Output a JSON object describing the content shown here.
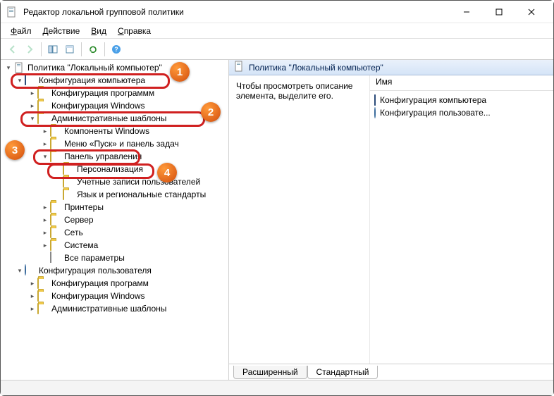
{
  "window": {
    "title": "Редактор локальной групповой политики"
  },
  "menu": {
    "file": "Файл",
    "action": "Действие",
    "view": "Вид",
    "help": "Справка"
  },
  "tree": {
    "root": "Политика \"Локальный компьютер\"",
    "computer_config": "Конфигурация компьютера",
    "cc_programs": "Конфигурация программм",
    "cc_windows": "Конфигурация Windows",
    "admin_templates": "Административные шаблоны",
    "at_components": "Компоненты Windows",
    "at_startmenu": "Меню «Пуск» и панель задач",
    "control_panel": "Панель управления",
    "cp_personalization": "Персонализация",
    "cp_accounts": "Учетные записи пользователей",
    "cp_language": "Язык и региональные стандарты",
    "at_printers": "Принтеры",
    "at_server": "Сервер",
    "at_network": "Сеть",
    "at_system": "Система",
    "at_allparams": "Все параметры",
    "user_config": "Конфигурация пользователя",
    "uc_programs": "Конфигурация программ",
    "uc_windows": "Конфигурация Windows",
    "uc_admin": "Административные шаблоны"
  },
  "right": {
    "header": "Политика \"Локальный компьютер\"",
    "description": "Чтобы просмотреть описание элемента, выделите его.",
    "col_name": "Имя",
    "item_computer": "Конфигурация компьютера",
    "item_user": "Конфигурация пользовате..."
  },
  "tabs": {
    "extended": "Расширенный",
    "standard": "Стандартный"
  },
  "badges": {
    "b1": "1",
    "b2": "2",
    "b3": "3",
    "b4": "4"
  }
}
